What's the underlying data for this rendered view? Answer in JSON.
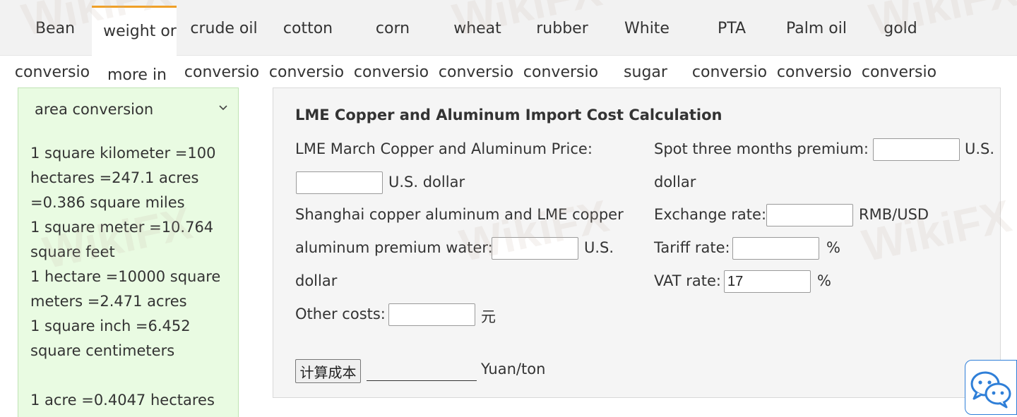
{
  "tabs": [
    {
      "top": "Bean",
      "bottom": "conversio"
    },
    {
      "top": "weight or",
      "bottom": "more in",
      "active": true
    },
    {
      "top": "crude oil",
      "bottom": "conversio"
    },
    {
      "top": "cotton",
      "bottom": "conversio"
    },
    {
      "top": "corn",
      "bottom": "conversio"
    },
    {
      "top": "wheat",
      "bottom": "conversio"
    },
    {
      "top": "rubber",
      "bottom": "conversio"
    },
    {
      "top": "White",
      "bottom": "sugar"
    },
    {
      "top": "PTA",
      "bottom": "conversio"
    },
    {
      "top": "Palm oil",
      "bottom": "conversio"
    },
    {
      "top": "gold",
      "bottom": "conversio"
    }
  ],
  "area_panel": {
    "title": "area conversion",
    "lines": [
      "1 square kilometer =100 hectares =247.1 acres =0.386 square miles",
      " 1 square meter =10.764 square feet",
      " 1 hectare =10000 square meters =2.471 acres",
      " 1 square inch =6.452 square centimeters",
      "1 acre =0.4047 hectares"
    ]
  },
  "calculator": {
    "title": "LME Copper and Aluminum Import Cost Calculation",
    "lme_price_label": " LME March Copper and Aluminum Price:",
    "lme_price_unit": "U.S. dollar",
    "lme_price_value": "",
    "spot_premium_label": " Spot three months premium:",
    "spot_premium_unit_1": "U.S.",
    "spot_premium_unit_2": "dollar",
    "spot_premium_value": "",
    "sh_premium_label_1": " Shanghai copper aluminum and LME copper",
    "sh_premium_label_2": "aluminum premium water:",
    "sh_premium_unit_1": "U.S.",
    "sh_premium_unit_2": "dollar",
    "sh_premium_value": "",
    "exchange_label": " Exchange rate:",
    "exchange_unit": "RMB/USD",
    "exchange_value": "",
    "tariff_label": " Tariff rate:",
    "tariff_unit": "%",
    "tariff_value": "",
    "vat_label": " VAT rate:",
    "vat_unit": "%",
    "vat_value": "17",
    "other_label": " Other costs:",
    "other_unit": "元",
    "other_value": "",
    "calc_button": "计算成本",
    "result_unit": "Yuan/ton"
  },
  "watermark_text": "WikiFX",
  "icons": {
    "collapse": "chevron-down-icon",
    "chat": "wechat-icon"
  },
  "colors": {
    "active_tab_accent": "#f0a028",
    "panel_green": "#e9fbe2",
    "chat_border": "#2f7fd8"
  }
}
